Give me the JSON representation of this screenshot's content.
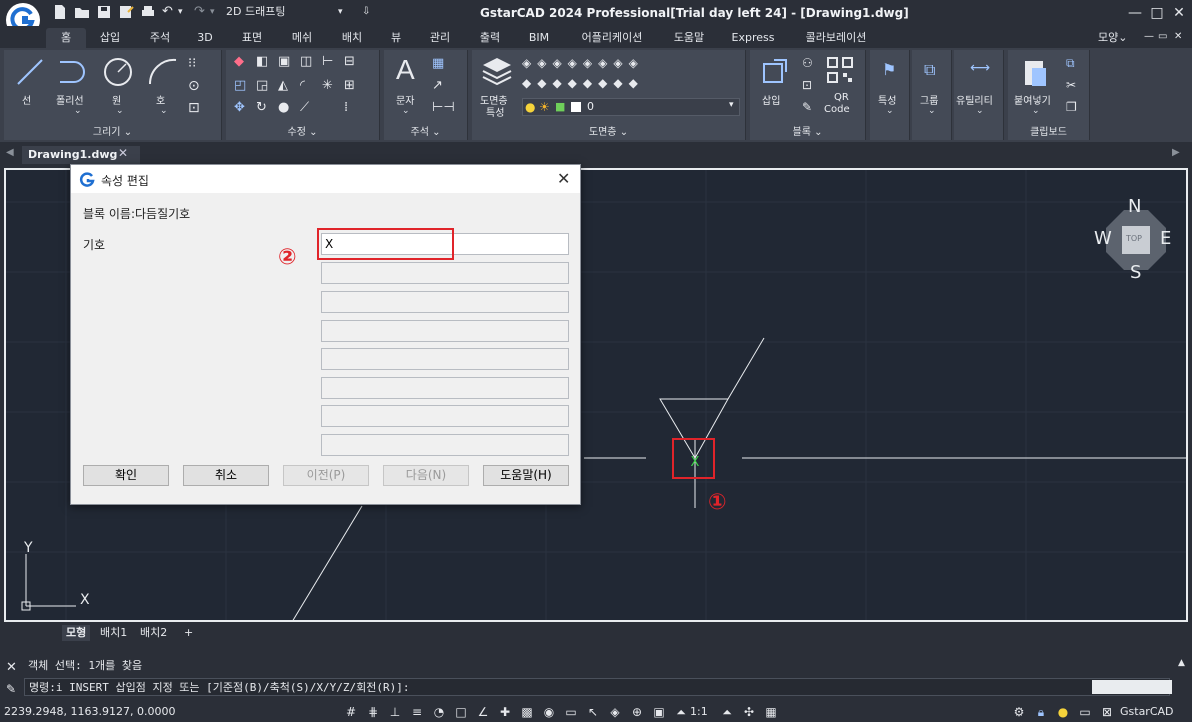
{
  "window": {
    "title": "GstarCAD 2024 Professional[Trial day left 24] - [Drawing1.dwg]",
    "workspace": "2D 드래프팅",
    "minimize": "—",
    "restore": "□",
    "close": "✕"
  },
  "menu_tabs": [
    "홈",
    "삽입",
    "주석",
    "3D",
    "표면",
    "메쉬",
    "배치",
    "뷰",
    "관리",
    "출력",
    "BIM",
    "어플리케이션",
    "도움말",
    "Express",
    "콜라보레이션"
  ],
  "menu_right": "모양",
  "ribbon": {
    "draw": {
      "title": "그리기",
      "line": "선",
      "polyline": "폴리선",
      "circle": "원",
      "arc": "호"
    },
    "modify": {
      "title": "수정"
    },
    "annotation": {
      "title": "주석",
      "text": "문자"
    },
    "layers": {
      "title": "도면층",
      "properties_line1": "도면층",
      "properties_line2": "특성",
      "current_layer": "0"
    },
    "block": {
      "title": "블록",
      "insert": "삽입",
      "qr": "QR",
      "qr2": "Code"
    },
    "properties": {
      "label": "특성"
    },
    "group": {
      "label": "그룹"
    },
    "utilities": {
      "label": "유틸리티"
    },
    "clipboard": {
      "title": "클립보드",
      "paste": "붙여넣기"
    }
  },
  "doc_tab": {
    "label": "Drawing1.dwg",
    "close": "✕"
  },
  "viewcube": {
    "n": "N",
    "s": "S",
    "e": "E",
    "w": "W",
    "top": "TOP"
  },
  "ucs": {
    "x": "X",
    "y": "Y"
  },
  "layout_tabs": [
    "모형",
    "배치1",
    "배치2",
    "+"
  ],
  "command": {
    "history": "객체 선택: 1개를 찾음",
    "prompt": "명령:i INSERT 삽입점 지정 또는 [기준점(B)/축척(S)/X/Y/Z/회전(R)]:"
  },
  "status": {
    "coords": "2239.2948, 1163.9127, 0.0000",
    "scale": "1:1",
    "brand": "GstarCAD"
  },
  "dialog": {
    "title": "속성 편집",
    "block_name": "블록 이름:다듬질기호",
    "attribute_label": "기호",
    "attribute_value": "X",
    "buttons": {
      "ok": "확인",
      "cancel": "취소",
      "prev": "이전(P)",
      "next": "다음(N)",
      "help": "도움말(H)"
    }
  },
  "annotations": {
    "one": "①",
    "two": "②"
  },
  "colors": {
    "accent_red": "#e0242a",
    "canvas_bg": "#212834",
    "ui_bg": "#2b2f38",
    "ribbon_bg": "#3b404b"
  }
}
